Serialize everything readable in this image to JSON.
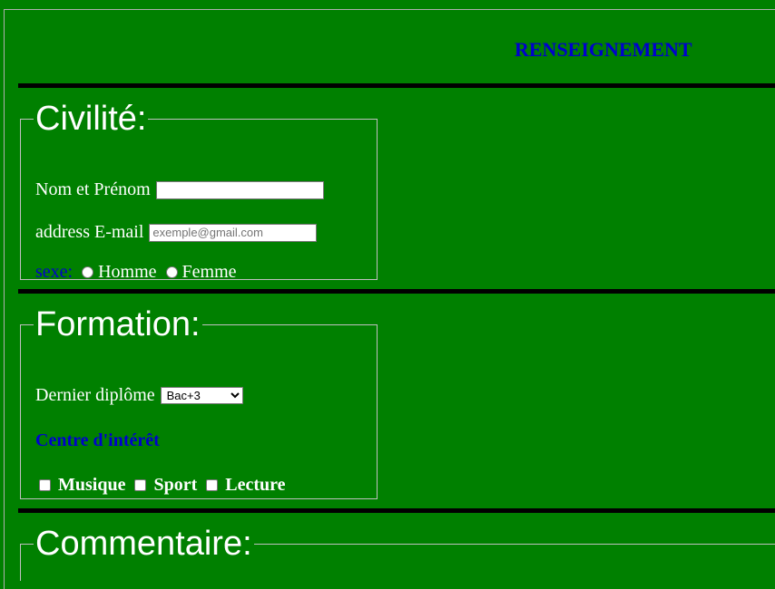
{
  "header": {
    "title": "RENSEIGNEMENT"
  },
  "civilite": {
    "legend": "Civilité:",
    "name_label": "Nom et Prénom",
    "name_value": "",
    "email_label": "address E-mail",
    "email_placeholder": "exemple@gmail.com",
    "sexe_label": "sexe:",
    "options": [
      "Homme",
      "Femme"
    ]
  },
  "formation": {
    "legend": "Formation:",
    "diplome_label": "Dernier diplôme",
    "diplome_selected": "Bac+3",
    "interest_title": "Centre d'intérêt",
    "interests": [
      "Musique",
      "Sport",
      "Lecture"
    ]
  },
  "commentaire": {
    "legend": "Commentaire:"
  },
  "colors": {
    "background": "#008000",
    "accent": "#0000cd",
    "rule": "#000000"
  }
}
